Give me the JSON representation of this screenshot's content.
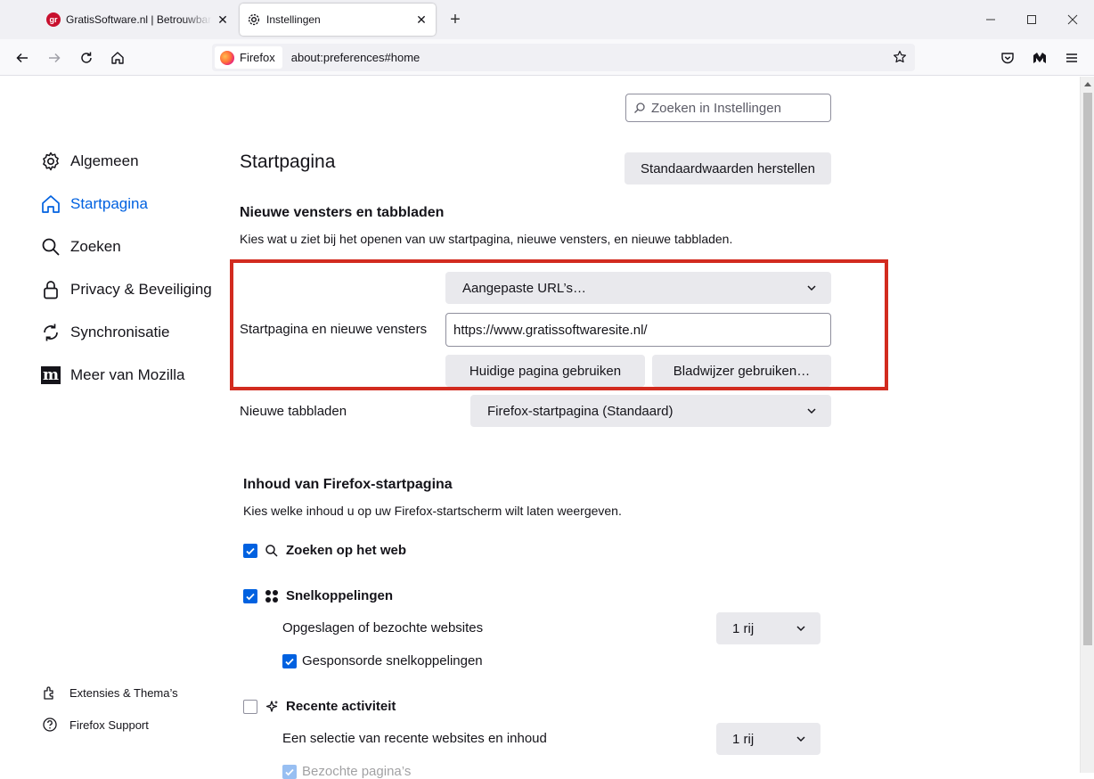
{
  "tabs": [
    {
      "title": "GratisSoftware.nl | Betrouwbare",
      "favicon": "gr"
    },
    {
      "title": "Instellingen"
    }
  ],
  "urlbar": {
    "identity": "Firefox",
    "url": "about:preferences#home"
  },
  "search": {
    "placeholder": "Zoeken in Instellingen"
  },
  "sidebar": {
    "items": [
      {
        "label": "Algemeen",
        "icon": "gear-icon"
      },
      {
        "label": "Startpagina",
        "icon": "home-icon"
      },
      {
        "label": "Zoeken",
        "icon": "search-icon"
      },
      {
        "label": "Privacy & Beveiliging",
        "icon": "lock-icon"
      },
      {
        "label": "Synchronisatie",
        "icon": "sync-icon"
      },
      {
        "label": "Meer van Mozilla",
        "icon": "mozilla-icon"
      }
    ],
    "footer": [
      {
        "label": "Extensies & Thema’s",
        "icon": "extension-icon"
      },
      {
        "label": "Firefox Support",
        "icon": "help-icon"
      }
    ]
  },
  "main": {
    "title": "Startpagina",
    "restore_label": "Standaardwaarden herstellen",
    "section1": {
      "heading": "Nieuwe vensters en tabbladen",
      "description": "Kies wat u ziet bij het openen van uw startpagina, nieuwe vensters, en nieuwe tabbladen.",
      "homepage_label": "Startpagina en nieuwe vensters",
      "homepage_select": "Aangepaste URL’s…",
      "homepage_url": "https://www.gratissoftwaresite.nl/",
      "use_current": "Huidige pagina gebruiken",
      "use_bookmark": "Bladwijzer gebruiken…",
      "newtab_label": "Nieuwe tabbladen",
      "newtab_select": "Firefox-startpagina (Standaard)"
    },
    "section2": {
      "heading": "Inhoud van Firefox-startpagina",
      "description": "Kies welke inhoud u op uw Firefox-startscherm wilt laten weergeven.",
      "web_search": {
        "label": "Zoeken op het web",
        "checked": true
      },
      "shortcuts": {
        "label": "Snelkoppelingen",
        "checked": true
      },
      "shortcuts_sub": "Opgeslagen of bezochte websites",
      "shortcuts_rows": "1 rij",
      "sponsored": {
        "label": "Gesponsorde snelkoppelingen",
        "checked": true
      },
      "recent": {
        "label": "Recente activiteit",
        "checked": false
      },
      "recent_sub": "Een selectie van recente websites en inhoud",
      "recent_rows": "1 rij",
      "visited": {
        "label": "Bezochte pagina’s",
        "checked": true
      }
    }
  },
  "colors": {
    "accent": "#0061e0",
    "highlight": "#d22b1f"
  }
}
